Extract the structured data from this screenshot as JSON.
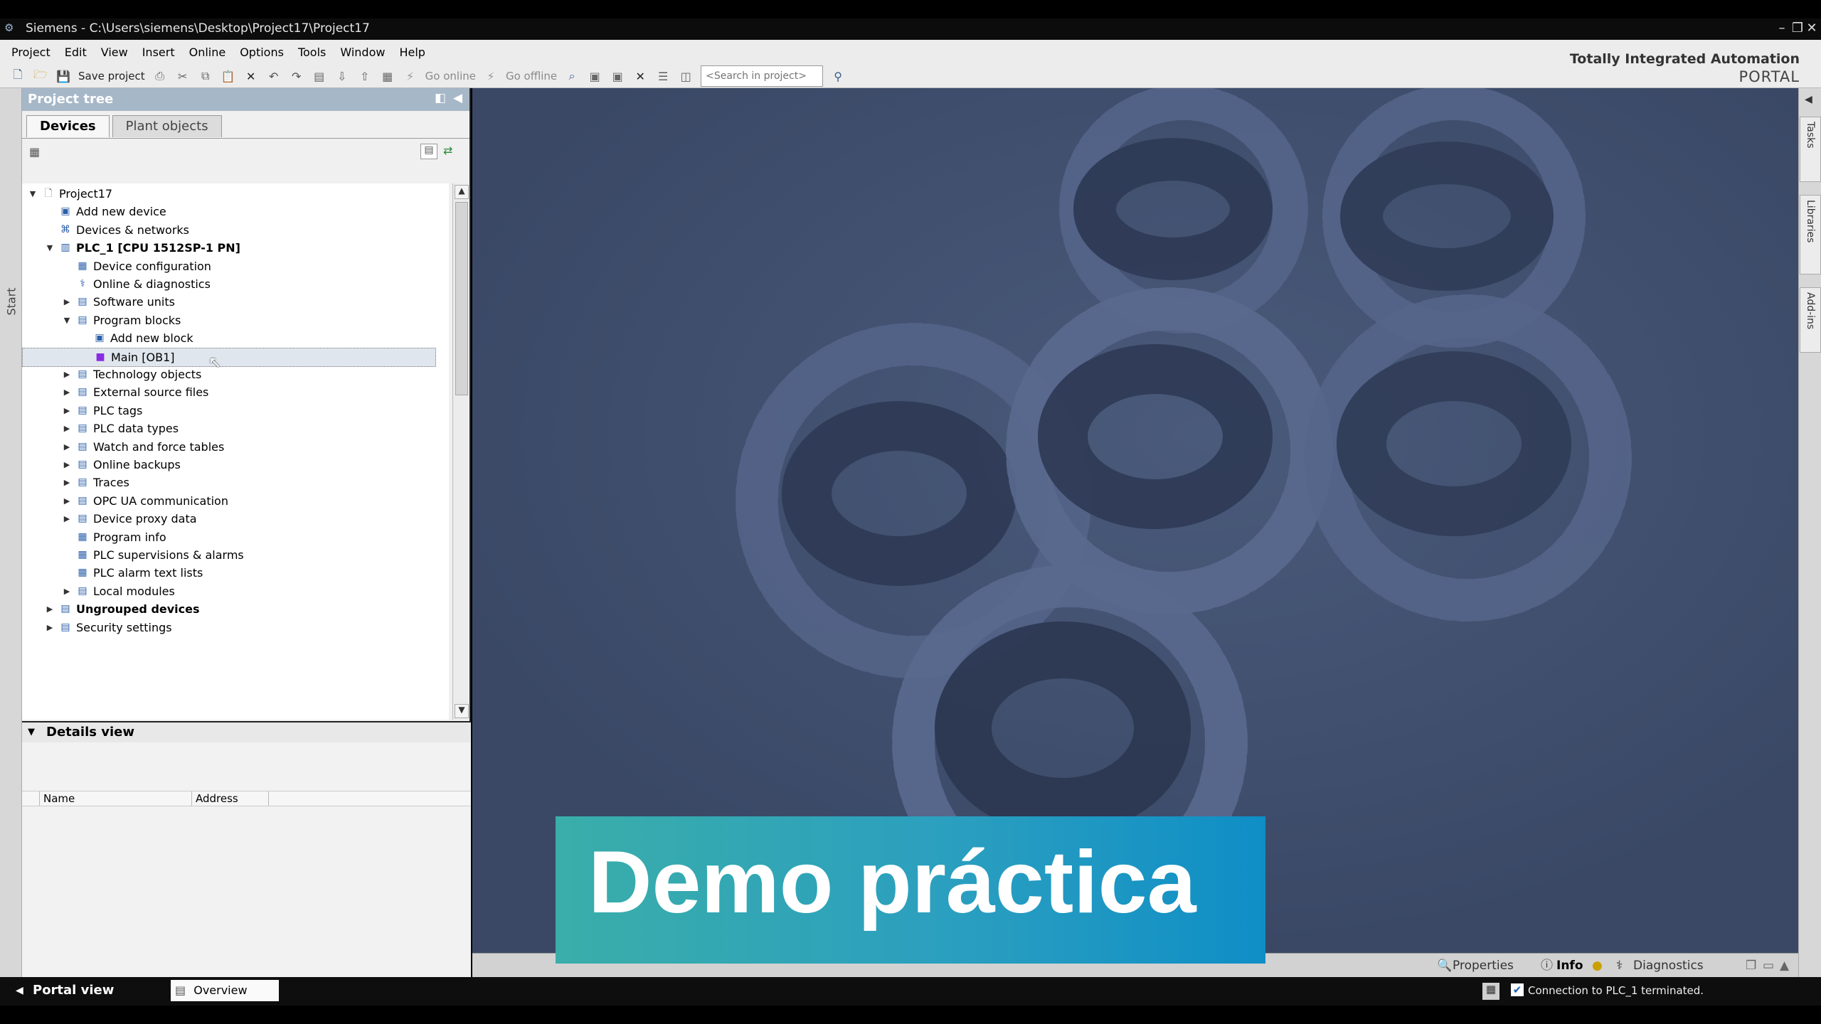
{
  "window": {
    "title": "Siemens - C:\\Users\\siemens\\Desktop\\Project17\\Project17"
  },
  "menu": [
    "Project",
    "Edit",
    "View",
    "Insert",
    "Online",
    "Options",
    "Tools",
    "Window",
    "Help"
  ],
  "toolbar": {
    "save_label": "Save project",
    "go_online": "Go online",
    "go_offline": "Go offline",
    "search_placeholder": "<Search in project>"
  },
  "brand": {
    "line1": "Totally Integrated Automation",
    "line2": "PORTAL"
  },
  "left_strip": {
    "label": "Start"
  },
  "project_tree": {
    "title": "Project tree",
    "tabs": [
      "Devices",
      "Plant objects"
    ],
    "items": [
      {
        "label": "Project17",
        "level": 0,
        "toggle": "expanded",
        "bold": false
      },
      {
        "label": "Add new device",
        "level": 1,
        "toggle": "none",
        "bold": false
      },
      {
        "label": "Devices & networks",
        "level": 1,
        "toggle": "none",
        "bold": false
      },
      {
        "label": "PLC_1 [CPU 1512SP-1 PN]",
        "level": 1,
        "toggle": "expanded",
        "bold": true
      },
      {
        "label": "Device configuration",
        "level": 2,
        "toggle": "none",
        "bold": false
      },
      {
        "label": "Online & diagnostics",
        "level": 2,
        "toggle": "none",
        "bold": false
      },
      {
        "label": "Software units",
        "level": 2,
        "toggle": "collapsed",
        "bold": false
      },
      {
        "label": "Program blocks",
        "level": 2,
        "toggle": "expanded",
        "bold": false
      },
      {
        "label": "Add new block",
        "level": 3,
        "toggle": "none",
        "bold": false
      },
      {
        "label": "Main [OB1]",
        "level": 3,
        "toggle": "none",
        "bold": false,
        "selected": true
      },
      {
        "label": "Technology objects",
        "level": 2,
        "toggle": "collapsed",
        "bold": false
      },
      {
        "label": "External source files",
        "level": 2,
        "toggle": "collapsed",
        "bold": false
      },
      {
        "label": "PLC tags",
        "level": 2,
        "toggle": "collapsed",
        "bold": false
      },
      {
        "label": "PLC data types",
        "level": 2,
        "toggle": "collapsed",
        "bold": false
      },
      {
        "label": "Watch and force tables",
        "level": 2,
        "toggle": "collapsed",
        "bold": false
      },
      {
        "label": "Online backups",
        "level": 2,
        "toggle": "collapsed",
        "bold": false
      },
      {
        "label": "Traces",
        "level": 2,
        "toggle": "collapsed",
        "bold": false
      },
      {
        "label": "OPC UA communication",
        "level": 2,
        "toggle": "collapsed",
        "bold": false
      },
      {
        "label": "Device proxy data",
        "level": 2,
        "toggle": "collapsed",
        "bold": false
      },
      {
        "label": "Program info",
        "level": 2,
        "toggle": "none",
        "bold": false
      },
      {
        "label": "PLC supervisions & alarms",
        "level": 2,
        "toggle": "none",
        "bold": false
      },
      {
        "label": "PLC alarm text lists",
        "level": 2,
        "toggle": "none",
        "bold": false
      },
      {
        "label": "Local modules",
        "level": 2,
        "toggle": "collapsed",
        "bold": false
      },
      {
        "label": "Ungrouped devices",
        "level": 1,
        "toggle": "collapsed",
        "bold": true
      },
      {
        "label": "Security settings",
        "level": 1,
        "toggle": "collapsed",
        "bold": false
      }
    ]
  },
  "details_view": {
    "title": "Details view",
    "columns": [
      "Name",
      "Address"
    ]
  },
  "bottom_tabs": {
    "properties": "Properties",
    "info": "Info",
    "diagnostics": "Diagnostics"
  },
  "right_strip": [
    "Tasks",
    "Libraries",
    "Add-ins"
  ],
  "portal_bar": {
    "portal_view": "Portal view",
    "overview": "Overview",
    "status": "Connection to PLC_1 terminated."
  },
  "banner": {
    "text": "Demo práctica"
  },
  "colors": {
    "main_background": "#3f4e6c",
    "tree_header": "#a6b7c8",
    "banner_start": "#3aaea9",
    "banner_end": "#0f8ec6"
  }
}
